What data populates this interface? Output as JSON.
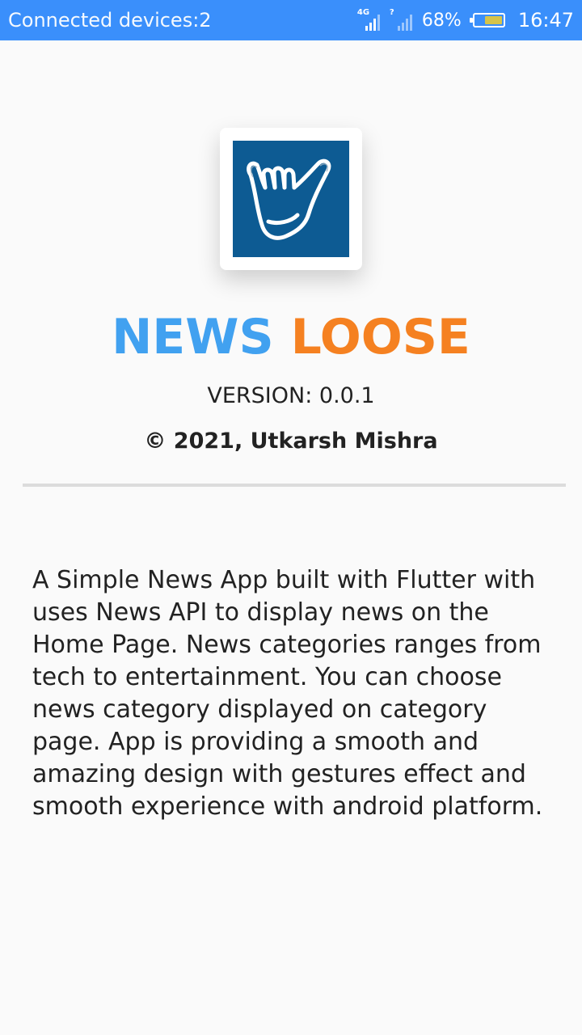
{
  "status_bar": {
    "left_text": "Connected devices:2",
    "network_tag_1": "4G",
    "network_tag_2": "?",
    "battery_percent": "68%",
    "battery_level": 0.68,
    "time": "16:47",
    "icons": [
      "signal-icon",
      "signal-icon",
      "battery-icon"
    ]
  },
  "about": {
    "logo_icon": "shaka-hand-icon",
    "logo_bg_color": "#0d5b93",
    "app_name_part1": "NEWS",
    "app_name_part2": "LOOSE",
    "app_name_color1": "#41a1f0",
    "app_name_color2": "#f58121",
    "version": "VERSION: 0.0.1",
    "copyright": "© 2021, Utkarsh Mishra",
    "description": "A Simple News App built with Flutter with uses News API to display news on the Home Page. News categories ranges from tech to entertainment. You can choose news category displayed on category page. App is providing a smooth and amazing design with gestures effect and smooth experience with android platform."
  },
  "colors": {
    "status_bar": "#3a8ffb",
    "background": "#fafafa"
  }
}
